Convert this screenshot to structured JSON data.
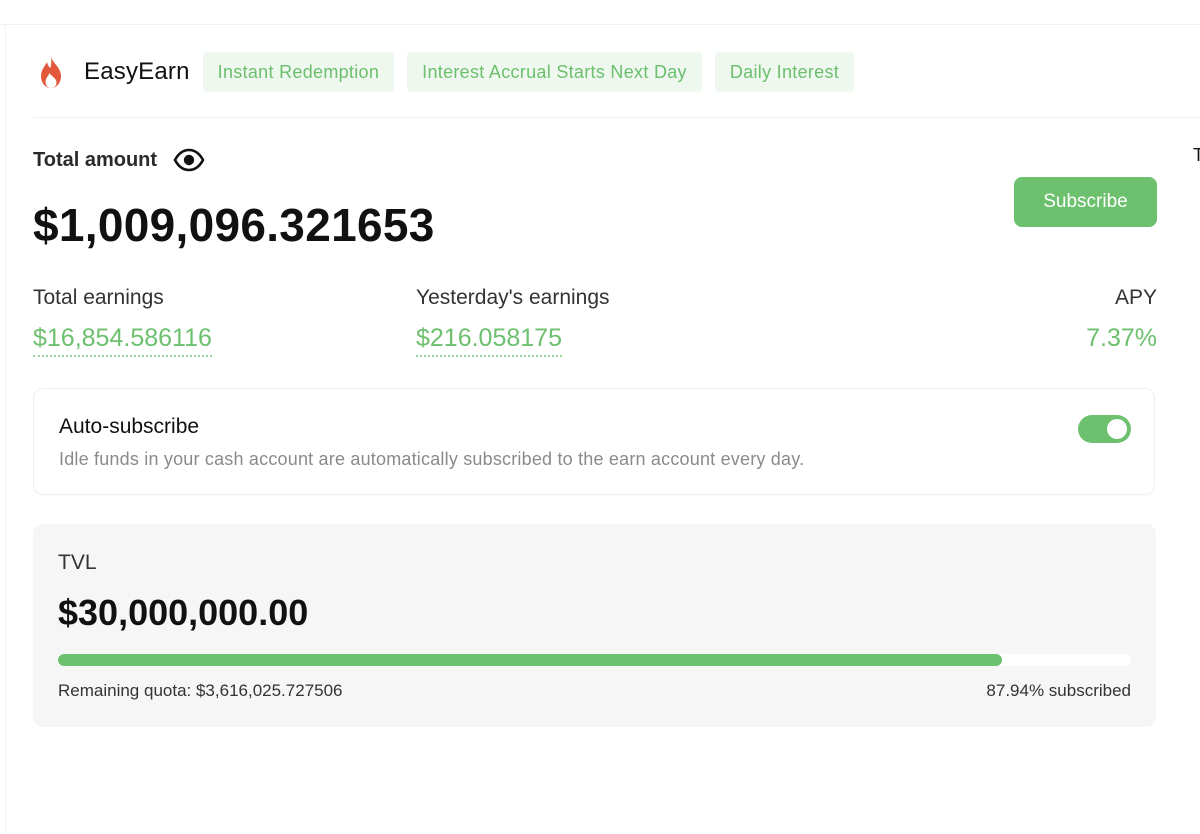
{
  "header": {
    "brand": "EasyEarn",
    "logo_icon": "flame-icon",
    "tags": [
      "Instant Redemption",
      "Interest Accrual Starts Next Day",
      "Daily Interest"
    ]
  },
  "summary": {
    "total_label": "Total amount",
    "visibility_icon": "eye-icon",
    "total_value": "$1,009,096.321653",
    "subscribe_label": "Subscribe"
  },
  "metrics": {
    "total_earnings_label": "Total earnings",
    "total_earnings_value": "$16,854.586116",
    "yesterday_label": "Yesterday's earnings",
    "yesterday_value": "$216.058175",
    "apy_label": "APY",
    "apy_value": "7.37%"
  },
  "auto_subscribe": {
    "title": "Auto-subscribe",
    "description": "Idle funds in your cash account are automatically subscribed to the earn account every day.",
    "enabled": true
  },
  "tvl": {
    "label": "TVL",
    "value": "$30,000,000.00",
    "progress_percent": 87.94,
    "remaining_quota": "Remaining quota: $3,616,025.727506",
    "subscribed_text": "87.94% subscribed"
  },
  "colors": {
    "accent": "#6cc06e",
    "tag_background": "#eff8ee",
    "tag_text": "#6bbf6d",
    "logo": "#e2583a"
  }
}
